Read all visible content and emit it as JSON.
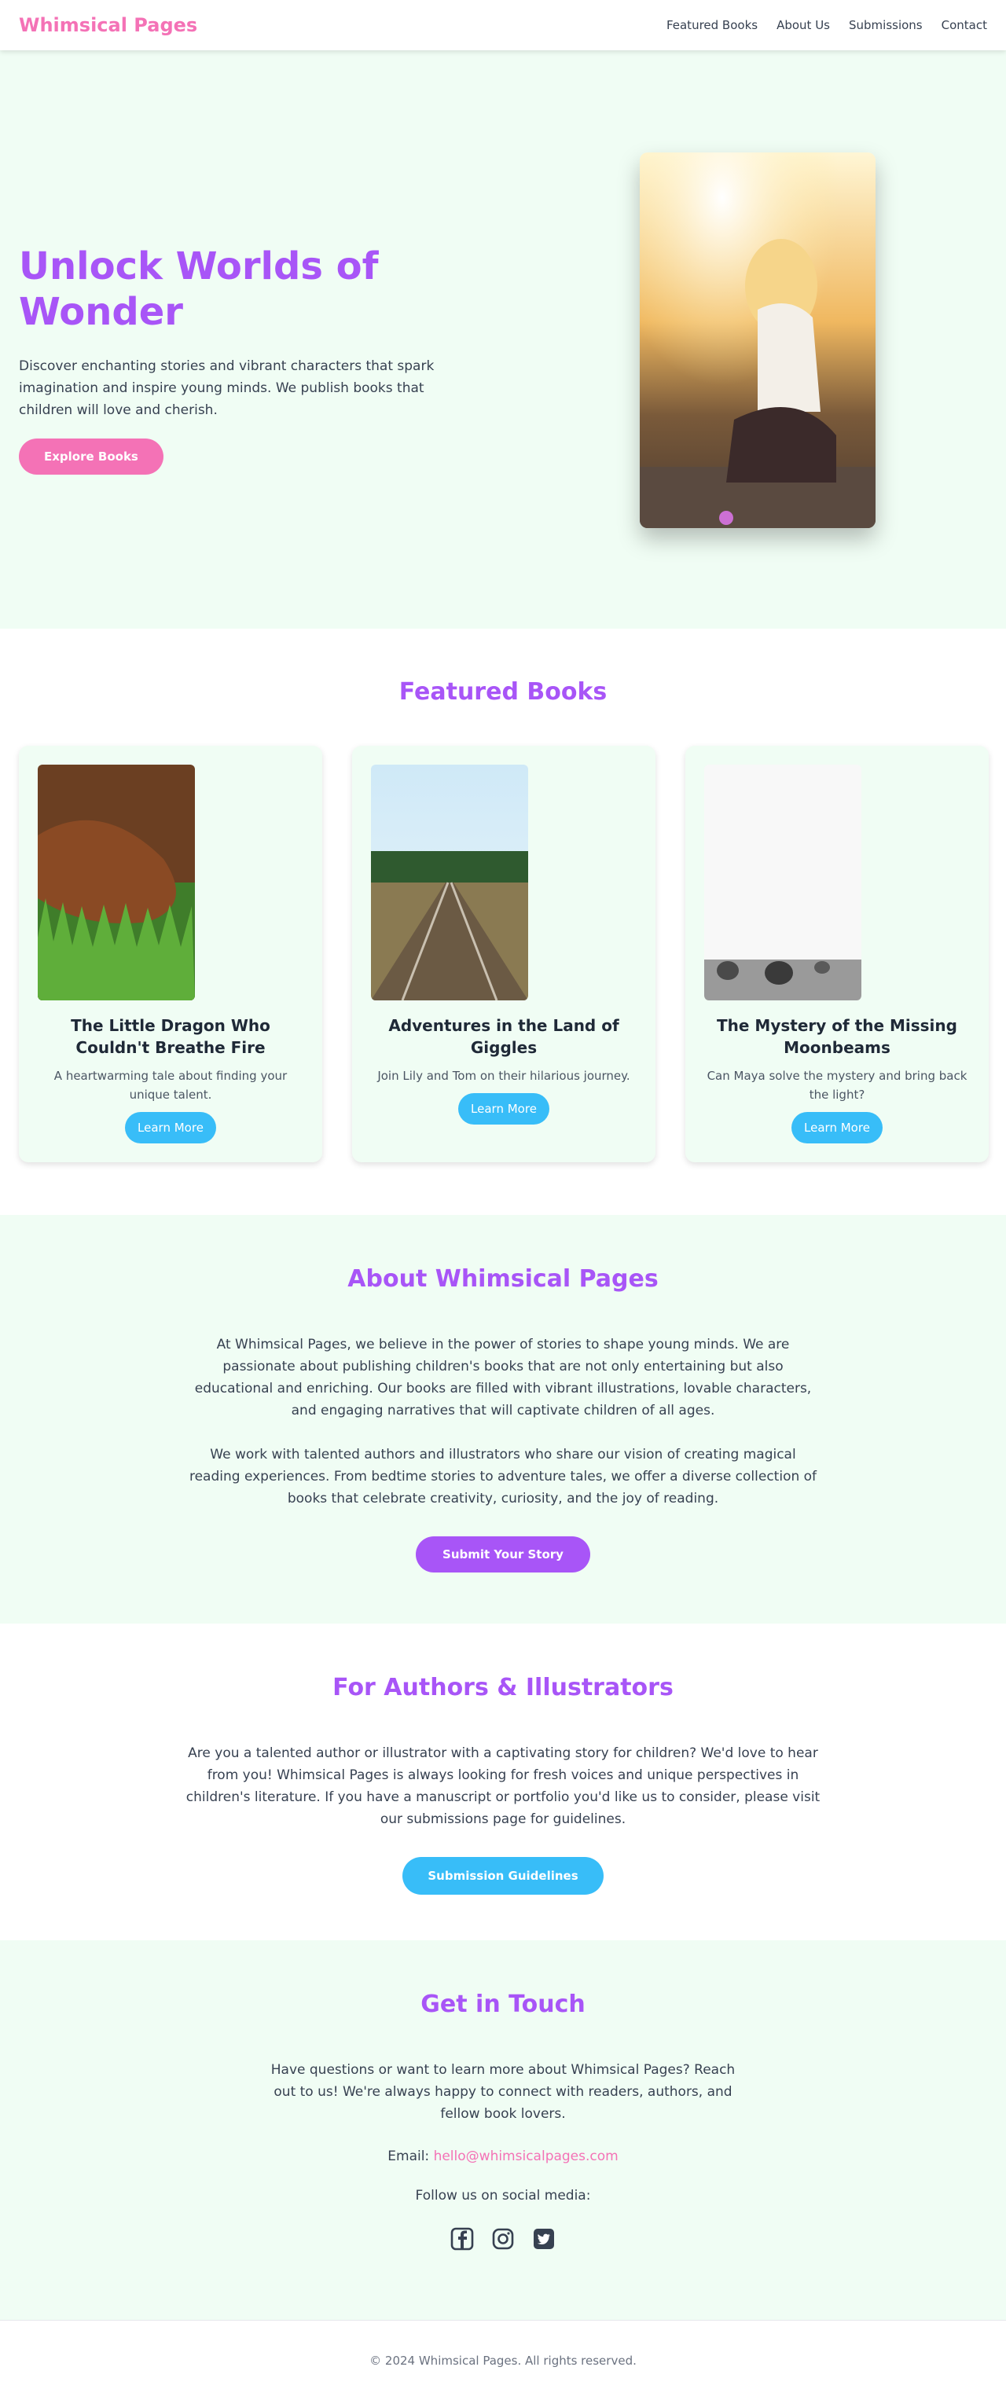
{
  "header": {
    "logo": "Whimsical Pages",
    "nav": [
      "Featured Books",
      "About Us",
      "Submissions",
      "Contact"
    ]
  },
  "hero": {
    "title": "Unlock Worlds of Wonder",
    "description": "Discover enchanting stories and vibrant characters that spark imagination and inspire young minds. We publish books that children will love and cherish.",
    "button": "Explore Books"
  },
  "featured": {
    "title": "Featured Books",
    "books": [
      {
        "title": "The Little Dragon Who Couldn't Breathe Fire",
        "description": "A heartwarming tale about finding your unique talent.",
        "button": "Learn More"
      },
      {
        "title": "Adventures in the Land of Giggles",
        "description": "Join Lily and Tom on their hilarious journey.",
        "button": "Learn More"
      },
      {
        "title": "The Mystery of the Missing Moonbeams",
        "description": "Can Maya solve the mystery and bring back the light?",
        "button": "Learn More"
      }
    ]
  },
  "about": {
    "title": "About Whimsical Pages",
    "paragraph1": "At Whimsical Pages, we believe in the power of stories to shape young minds. We are passionate about publishing children's books that are not only entertaining but also educational and enriching. Our books are filled with vibrant illustrations, lovable characters, and engaging narratives that will captivate children of all ages.",
    "paragraph2": "We work with talented authors and illustrators who share our vision of creating magical reading experiences. From bedtime stories to adventure tales, we offer a diverse collection of books that celebrate creativity, curiosity, and the joy of reading.",
    "button": "Submit Your Story"
  },
  "authors": {
    "title": "For Authors & Illustrators",
    "paragraph": "Are you a talented author or illustrator with a captivating story for children? We'd love to hear from you! Whimsical Pages is always looking for fresh voices and unique perspectives in children's literature. If you have a manuscript or portfolio you'd like us to consider, please visit our submissions page for guidelines.",
    "button": "Submission Guidelines"
  },
  "contact": {
    "title": "Get in Touch",
    "paragraph": "Have questions or want to learn more about Whimsical Pages? Reach out to us! We're always happy to connect with readers, authors, and fellow book lovers.",
    "email_label": "Email:",
    "email": "hello@whimsicalpages.com",
    "follow": "Follow us on social media:",
    "social_icons": [
      "facebook-icon",
      "instagram-icon",
      "twitter-icon"
    ]
  },
  "footer": {
    "copyright": "© 2024 Whimsical Pages. All rights reserved."
  },
  "colors": {
    "brand_pink": "#f472b6",
    "brand_purple": "#a855f7",
    "brand_blue": "#38bdf8",
    "section_bg": "#f0fdf4"
  }
}
